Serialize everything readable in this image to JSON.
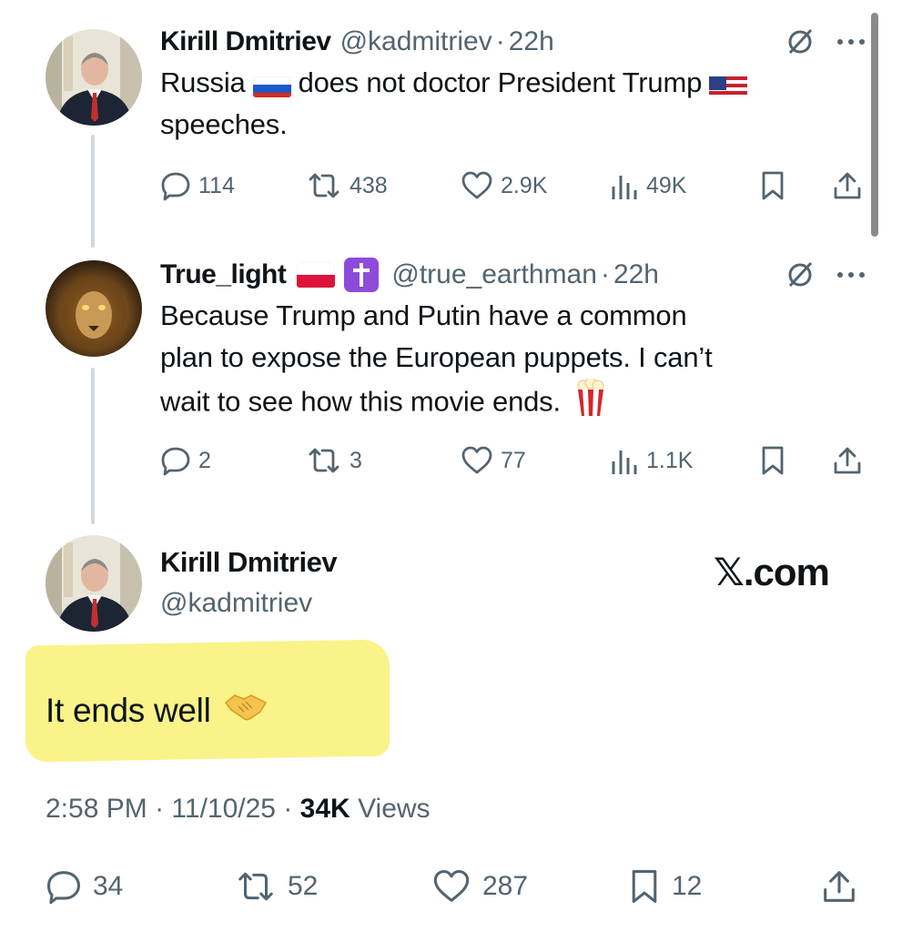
{
  "tweets": [
    {
      "name": "Kirill Dmitriev",
      "handle": "@kadmitriev",
      "time": "22h",
      "text_line1_a": "Russia",
      "text_line1_b": "does not doctor President Trump",
      "text_line2": "speeches.",
      "replies": "114",
      "retweets": "438",
      "likes": "2.9K",
      "views": "49K"
    },
    {
      "name": "True_light",
      "handle": "@true_earthman",
      "time": "22h",
      "text_line1": "Because Trump and Putin have a common",
      "text_line2": "plan to expose the European puppets. I can’t",
      "text_line3": "wait to see how this movie ends.",
      "replies": "2",
      "retweets": "3",
      "likes": "77",
      "views": "1.1K"
    }
  ],
  "main_tweet": {
    "name": "Kirill Dmitriev",
    "handle": "@kadmitriev",
    "brand": "𝕏.com",
    "text": "It ends well",
    "time": "2:58 PM",
    "date": "11/10/25",
    "views_count": "34K",
    "views_label": "Views",
    "replies": "34",
    "retweets": "52",
    "likes": "287",
    "bookmarks": "12"
  },
  "separator": "·",
  "icons": [
    "reply-icon",
    "retweet-icon",
    "like-icon",
    "views-icon",
    "bookmark-icon",
    "share-icon",
    "grok-icon",
    "more-icon",
    "flag-russia-icon",
    "flag-usa-icon",
    "flag-poland-icon",
    "cross-icon",
    "popcorn-icon",
    "handshake-icon"
  ],
  "colors": {
    "text": "#0f1419",
    "muted": "#536471",
    "thread_line": "#cfd9de",
    "highlight": "#f9f38a"
  }
}
